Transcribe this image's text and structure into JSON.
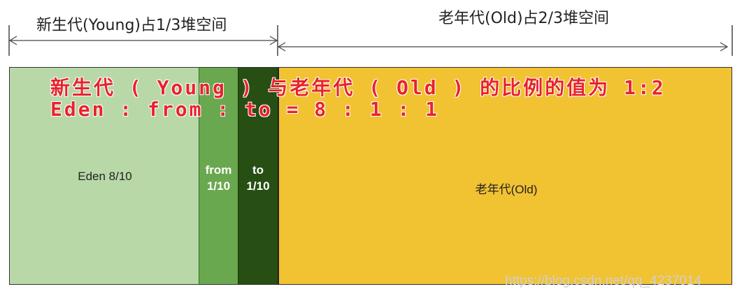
{
  "labels": {
    "young_span": "新生代(Young)占1/3堆空间",
    "old_span": "老年代(Old)占2/3堆空间"
  },
  "regions": {
    "eden": "Eden  8/10",
    "from_line1": "from",
    "from_line2": "1/10",
    "to_line1": "to",
    "to_line2": "1/10",
    "old": "老年代(Old)"
  },
  "overlay": {
    "line1": "新生代 ( Young ) 与老年代 ( Old ) 的比例的值为 1:2",
    "line2": "Eden : from : to = 8 : 1 : 1"
  },
  "watermark": "https://blog.csdn.net/qq_4237014",
  "colors": {
    "eden": "#b8d8a8",
    "from": "#6aa84f",
    "to": "#274e13",
    "old": "#f1c232",
    "overlay_text": "#e8232b"
  }
}
